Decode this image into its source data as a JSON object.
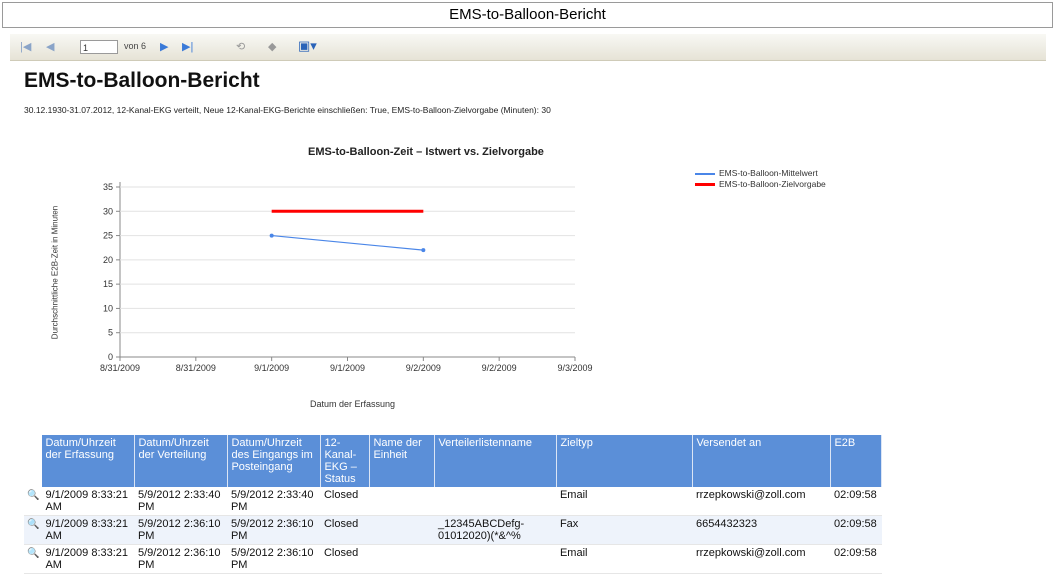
{
  "window": {
    "title": "EMS-to-Balloon-Bericht"
  },
  "toolbar": {
    "page": "1",
    "of_label": "von 6"
  },
  "report": {
    "title": "EMS-to-Balloon-Bericht",
    "params": "30.12.1930-31.07.2012, 12-Kanal-EKG verteilt, Neue 12-Kanal-EKG-Berichte einschließen: True, EMS-to-Balloon-Zielvorgabe (Minuten): 30"
  },
  "chart_data": {
    "type": "line",
    "title": "EMS-to-Balloon-Zeit – Istwert vs. Zielvorgabe",
    "xlabel": "Datum der Erfassung",
    "ylabel": "Durchschnittliche E2B-Zeit in Minuten",
    "x_ticks": [
      "8/31/2009",
      "8/31/2009",
      "9/1/2009",
      "9/1/2009",
      "9/2/2009",
      "9/2/2009",
      "9/3/2009"
    ],
    "y_ticks": [
      0,
      5,
      10,
      15,
      20,
      25,
      30,
      35
    ],
    "ylim": [
      0,
      35
    ],
    "grid": "horizontal",
    "legend": "top-right",
    "series": [
      {
        "name": "EMS-to-Balloon-Mittelwert",
        "color": "#4a86e8",
        "points": [
          {
            "x": "9/1/2009",
            "y": 25
          },
          {
            "x": "9/2/2009",
            "y": 22
          }
        ]
      },
      {
        "name": "EMS-to-Balloon-Zielvorgabe",
        "color": "#ff0000",
        "points": [
          {
            "x": "9/1/2009",
            "y": 30
          },
          {
            "x": "9/2/2009",
            "y": 30
          }
        ]
      }
    ]
  },
  "table": {
    "headers": [
      "Datum/Uhrzeit der Erfassung",
      "Datum/Uhrzeit der Verteilung",
      "Datum/Uhrzeit des Eingangs im Posteingang",
      "12-Kanal-EKG – Status",
      "Name der Einheit",
      "Verteilerlistenname",
      "Zieltyp",
      "Versendet an",
      "E2B"
    ],
    "rows": [
      [
        "9/1/2009 8:33:21 AM",
        "5/9/2012 2:33:40 PM",
        "5/9/2012 2:33:40 PM",
        "Closed",
        "",
        "",
        "Email",
        "rrzepkowski@zoll.com",
        "02:09:58"
      ],
      [
        "9/1/2009 8:33:21 AM",
        "5/9/2012 2:36:10 PM",
        "5/9/2012 2:36:10 PM",
        "Closed",
        "",
        "_12345ABCDefg-01012020)(*&^%",
        "Fax",
        "6654432323",
        "02:09:58"
      ],
      [
        "9/1/2009 8:33:21 AM",
        "5/9/2012 2:36:10 PM",
        "5/9/2012 2:36:10 PM",
        "Closed",
        "",
        "",
        "Email",
        "rrzepkowski@zoll.com",
        "02:09:58"
      ]
    ]
  }
}
